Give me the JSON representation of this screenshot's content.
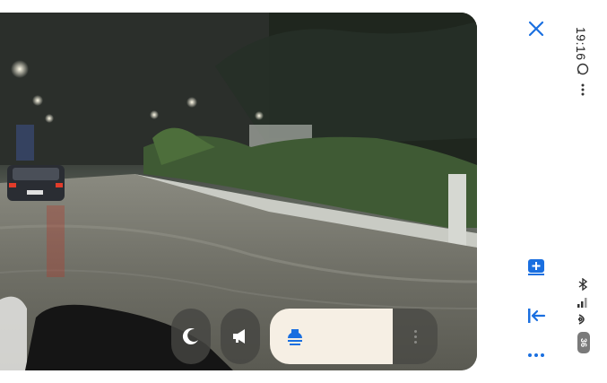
{
  "video": {
    "description_icon": "flooded-street-video"
  },
  "controls": {
    "buttons": [
      {
        "name": "moon-icon"
      },
      {
        "name": "megaphone-icon"
      }
    ],
    "mini_panel_icon": "speaker-bell-icon"
  },
  "toolbar": {
    "close_icon": "close-icon",
    "add_icon": "add-window-icon",
    "collapse_icon": "arrow-left-bar-icon",
    "more_icon": "more-icon"
  },
  "status_bar": {
    "time": "19:16",
    "battery": "36",
    "icons": [
      "whatsapp-icon",
      "more-vertical-icon",
      "bluetooth-icon",
      "signal-icon",
      "wifi-icon"
    ]
  },
  "colors": {
    "accent": "#1a6fe0",
    "panel": "#f6efe4"
  }
}
